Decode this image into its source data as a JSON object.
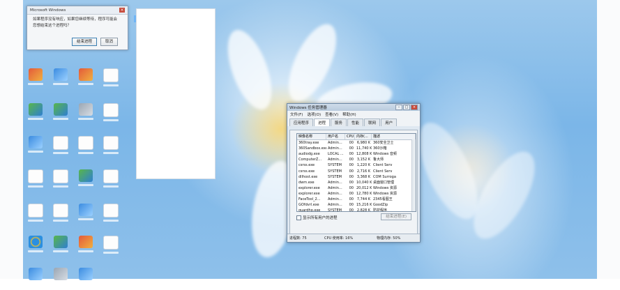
{
  "message_dialog": {
    "title": "Microsoft Windows",
    "line1": "如果程序没有响应，如果您继续等待，程序可能会",
    "line2": "您想结束这个进程吗？",
    "end_process_label": "结束进程",
    "cancel_label": "取消"
  },
  "task_manager": {
    "title": "Windows 任务管理器",
    "menu": [
      "文件(F)",
      "选项(O)",
      "查看(V)",
      "帮助(H)"
    ],
    "tabs": [
      "应用程序",
      "进程",
      "服务",
      "性能",
      "联网",
      "用户"
    ],
    "active_tab": "进程",
    "columns": [
      "映像名称",
      "用户名",
      "CPU",
      "内存(...",
      "描述"
    ],
    "rows": [
      [
        "360tray.exe",
        "Admin...",
        "00",
        "6,980 K",
        "360安全卫士"
      ],
      [
        "360Sandbox.exe",
        "Admin...",
        "00",
        "11,740 K",
        "360沙箱"
      ],
      [
        "audiodg.exe",
        "LOCAL ...",
        "00",
        "12,808 K",
        "Windows 音频"
      ],
      [
        "ComputerZ...",
        "Admin...",
        "00",
        "3,152 K",
        "鲁大师"
      ],
      [
        "csrss.exe",
        "SYSTEM",
        "00",
        "1,220 K",
        "Client Serv"
      ],
      [
        "csrss.exe",
        "SYSTEM",
        "00",
        "2,716 K",
        "Client Serv"
      ],
      [
        "dllhost.exe",
        "SYSTEM",
        "00",
        "3,368 K",
        "COM Surroga"
      ],
      [
        "dwm.exe",
        "Admin...",
        "00",
        "10,040 K",
        "桌面窗口管理"
      ],
      [
        "explorer.exe",
        "Admin...",
        "00",
        "20,012 K",
        "Windows 资源"
      ],
      [
        "explorer.exe",
        "Admin...",
        "00",
        "12,780 K",
        "Windows 资源"
      ],
      [
        "FaceTool_2...",
        "Admin...",
        "00",
        "7,744 K",
        "2345看图王"
      ],
      [
        "GOfdvrl.exe",
        "Admin...",
        "00",
        "15,216 K",
        "GoodZip"
      ],
      [
        "guardhp.exe",
        "SYSTEM",
        "00",
        "2,828 K",
        "防护程序"
      ],
      [
        "HauxipDsv.exe",
        "SYSTEM",
        "00",
        "1,648 K",
        "好压核心服务"
      ]
    ],
    "show_all_users_label": "显示所有用户的进程",
    "end_process_label": "结束进程(E)",
    "status": {
      "processes": "进程数: 75",
      "cpu": "CPU 使用率: 16%",
      "memory": "物理内存: 50%"
    }
  },
  "colors": {
    "desktop_sky": "#8ec0ea",
    "window_frame": "#6d8aa8",
    "close_red": "#c74a3a"
  }
}
